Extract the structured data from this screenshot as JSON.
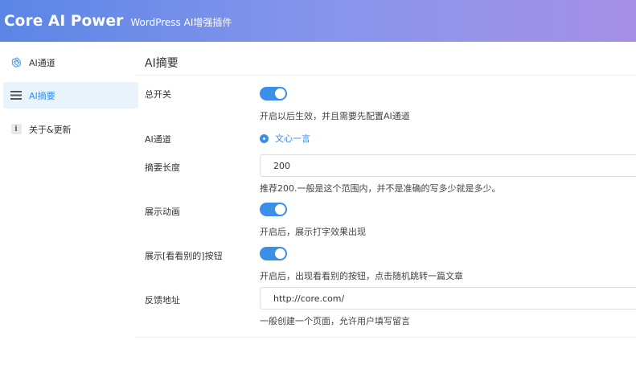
{
  "header": {
    "brand": "Core AI Power",
    "subtitle": "WordPress AI增强插件"
  },
  "sidebar": {
    "items": [
      {
        "label": "AI通道",
        "icon": "openai-icon",
        "active": false
      },
      {
        "label": "AI摘要",
        "icon": "list-icon",
        "active": true
      },
      {
        "label": "关于&更新",
        "icon": "info-icon",
        "active": false
      }
    ]
  },
  "main": {
    "title": "AI摘要",
    "master_switch": {
      "label": "总开关",
      "on": true,
      "desc": "开启以后生效，并且需要先配置AI通道"
    },
    "channel": {
      "label": "AI通道",
      "option": "文心一言",
      "selected": true
    },
    "summary_length": {
      "label": "摘要长度",
      "value": "200",
      "desc": "推荐200.一般是这个范围内，并不是准确的写多少就是多少。"
    },
    "show_animation": {
      "label": "展示动画",
      "on": true,
      "desc": "开启后，展示打字效果出现"
    },
    "show_others": {
      "label": "展示[看看别的]按钮",
      "on": true,
      "desc": "开启后，出现看看别的按钮，点击随机跳转一篇文章"
    },
    "feedback_url": {
      "label": "反馈地址",
      "value": "http://core.com/",
      "desc": "一般创建一个页面，允许用户填写留言"
    }
  },
  "colors": {
    "accent": "#3a8ee6",
    "toggle_on": "#3b8fe8",
    "active_bg": "#e8f3fc",
    "header_start": "#5b86e6",
    "header_end": "#a58fe6"
  }
}
